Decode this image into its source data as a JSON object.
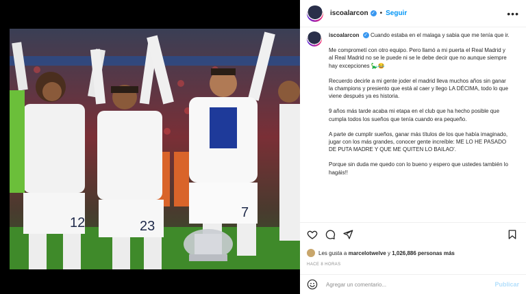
{
  "post": {
    "username": "iscoalarcon",
    "follow_label": "Seguir",
    "more_label": "•••",
    "caption": {
      "username": "iscoalarcon",
      "paragraphs": [
        "Cuando estaba en el malaga y sabia que me tenía que ir.",
        "Me comprometí con otro equipo. Pero llamó a mi puerta el Real Madrid y al Real Madrid no se le puede ni se le debe decir que no aunque siempre hay excepciones 🦕😂",
        "Recuerdo decirle a mi gente joder el madrid lleva muchos años sin ganar la champions y presiento que está al caer y llego LA DÉCIMA, todo lo que viene después ya es historia.",
        "9 años más tarde acaba mi etapa en el club que ha hecho posible que cumpla todos los sueños que tenía cuando era pequeño.",
        "A parte de cumplir sueños, ganar más títulos de los que había imaginado, jugar con los más grandes, conocer gente increíble: ME LO HE PASADO DE PUTA MADRE Y QUE ME QUITEN LO BAILAO'.",
        "Porque sin duda me quedo con lo bueno y espero que ustedes también lo hagáis!!"
      ]
    },
    "likes": {
      "prefix": "Les gusta a",
      "user": "marcelotwelve",
      "connector": "y",
      "others": "1,026,886 personas más"
    },
    "time_ago": "HACE 8 HORAS",
    "comment": {
      "placeholder": "Agregar un comentario...",
      "post_label": "Publicar"
    },
    "photo": {
      "jersey_numbers": [
        "12",
        "23",
        "7"
      ]
    }
  },
  "icons": {
    "like": "heart-icon",
    "comment": "comment-icon",
    "share": "share-icon",
    "save": "bookmark-icon",
    "emoji": "smile-icon"
  },
  "colors": {
    "accent": "#0095f6",
    "verified": "#3897f0",
    "post_disabled": "#b2dffc"
  }
}
